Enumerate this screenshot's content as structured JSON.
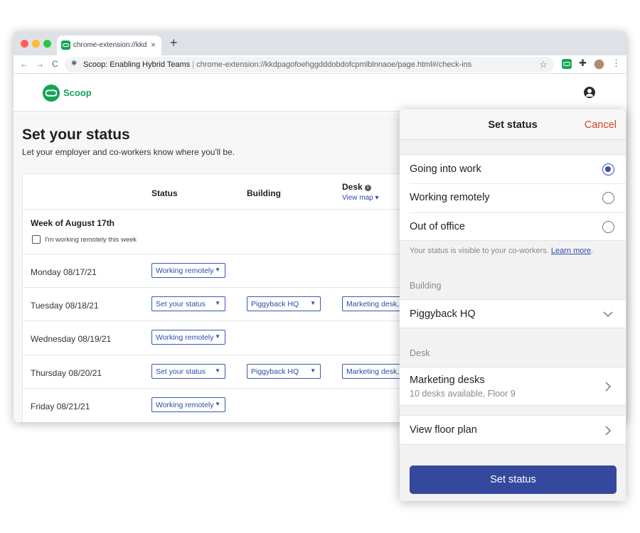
{
  "browser": {
    "tab_title": "chrome-extension://kkdp",
    "tab_close": "×",
    "new_tab": "+",
    "page_title": "Scoop: Enabling Hybrid Teams",
    "url_separator": "|",
    "url": "chrome-extension://kkdpagofoehggdddobdofcpmlblnnaoe/page.html#/check-ins",
    "nav": {
      "back": "←",
      "forward": "→",
      "reload": "C"
    }
  },
  "app": {
    "brand": "Scoop",
    "brand_color": "#12a454",
    "accent_color": "#2e4aa8"
  },
  "page": {
    "title": "Set your status",
    "subtitle": "Let your employer and co-workers know where you'll be.",
    "columns": {
      "status": "Status",
      "building": "Building",
      "desk": "Desk",
      "view_map": "View map"
    },
    "week": {
      "title": "Week of August 17th",
      "checkbox_label": "I'm working remotely this week",
      "checked": false
    },
    "days": [
      {
        "day": "Monday 08/17/21",
        "status": "Working remotely",
        "building": "",
        "desk": ""
      },
      {
        "day": "Tuesday 08/18/21",
        "status": "Set your status",
        "building": "Piggyback HQ",
        "desk": "Marketing desk,"
      },
      {
        "day": "Wednesday 08/19/21",
        "status": "Working remotely",
        "building": "",
        "desk": ""
      },
      {
        "day": "Thursday 08/20/21",
        "status": "Set your status",
        "building": "Piggyback HQ",
        "desk": "Marketing desk,"
      },
      {
        "day": "Friday 08/21/21",
        "status": "Working remotely",
        "building": "",
        "desk": ""
      }
    ]
  },
  "panel": {
    "title": "Set status",
    "cancel": "Cancel",
    "options": [
      {
        "label": "Going into work",
        "selected": true
      },
      {
        "label": "Working remotely",
        "selected": false
      },
      {
        "label": "Out of office",
        "selected": false
      }
    ],
    "note": "Your status is visible to your co-workers.",
    "note_link": "Learn more",
    "note_end": ".",
    "building_label": "Building",
    "building_value": "Piggyback HQ",
    "desk_label": "Desk",
    "desk_value": "Marketing desks",
    "desk_detail": "10 desks available, Floor 9",
    "floor_plan": "View floor plan",
    "submit": "Set status",
    "submit_color": "#34489d",
    "cancel_color": "#d4451c"
  }
}
